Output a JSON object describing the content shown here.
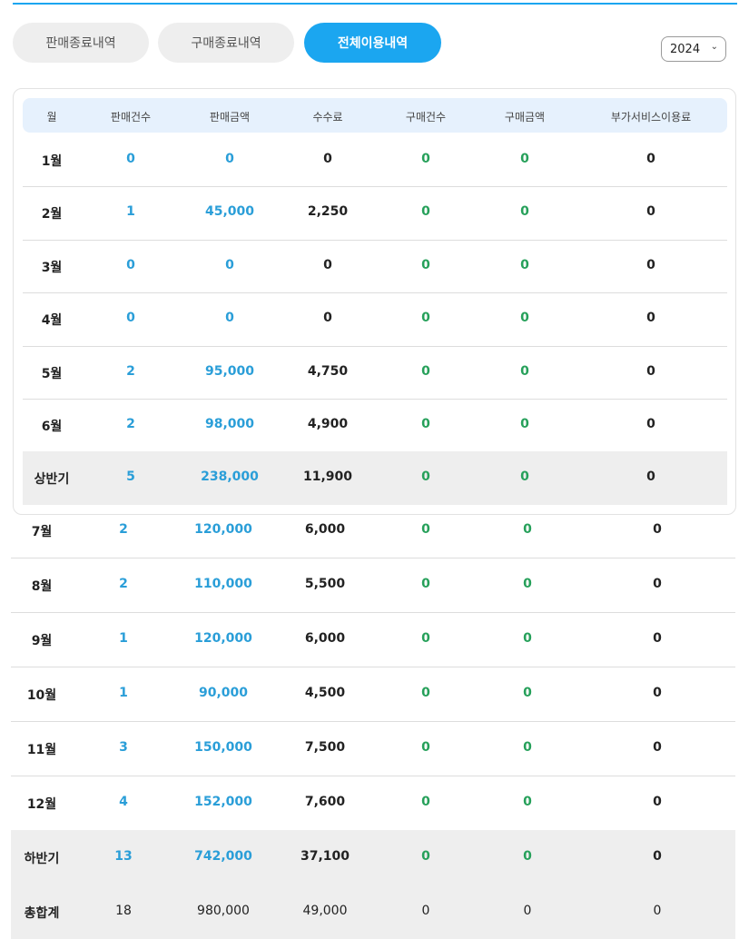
{
  "tabs": [
    {
      "label": "판매종료내역",
      "active": false
    },
    {
      "label": "구매종료내역",
      "active": false
    },
    {
      "label": "전체이용내역",
      "active": true
    }
  ],
  "year_select": {
    "value": "2024"
  },
  "table": {
    "headers": [
      "월",
      "판매건수",
      "판매금액",
      "수수료",
      "구매건수",
      "구매금액",
      "부가서비스이용료"
    ],
    "rows_top": [
      [
        "1월",
        "0",
        "0",
        "0",
        "0",
        "0",
        "0"
      ],
      [
        "2월",
        "1",
        "45,000",
        "2,250",
        "0",
        "0",
        "0"
      ],
      [
        "3월",
        "0",
        "0",
        "0",
        "0",
        "0",
        "0"
      ],
      [
        "4월",
        "0",
        "0",
        "0",
        "0",
        "0",
        "0"
      ],
      [
        "5월",
        "2",
        "95,000",
        "4,750",
        "0",
        "0",
        "0"
      ],
      [
        "6월",
        "2",
        "98,000",
        "4,900",
        "0",
        "0",
        "0"
      ],
      [
        "상반기",
        "5",
        "238,000",
        "11,900",
        "0",
        "0",
        "0"
      ]
    ],
    "rows_bottom": [
      [
        "7월",
        "2",
        "120,000",
        "6,000",
        "0",
        "0",
        "0"
      ],
      [
        "8월",
        "2",
        "110,000",
        "5,500",
        "0",
        "0",
        "0"
      ],
      [
        "9월",
        "1",
        "120,000",
        "6,000",
        "0",
        "0",
        "0"
      ],
      [
        "10월",
        "1",
        "90,000",
        "4,500",
        "0",
        "0",
        "0"
      ],
      [
        "11월",
        "3",
        "150,000",
        "7,500",
        "0",
        "0",
        "0"
      ],
      [
        "12월",
        "4",
        "152,000",
        "7,600",
        "0",
        "0",
        "0"
      ],
      [
        "하반기",
        "13",
        "742,000",
        "37,100",
        "0",
        "0",
        "0"
      ],
      [
        "총합계",
        "18",
        "980,000",
        "49,000",
        "0",
        "0",
        "0"
      ]
    ]
  },
  "colors": {
    "accent": "#1ba6f0",
    "value_blue": "#2a9ed8",
    "value_green": "#26a05a"
  }
}
